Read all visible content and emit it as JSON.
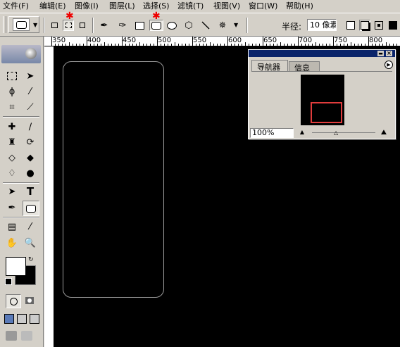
{
  "menubar": {
    "items": [
      {
        "label": "文件(F)"
      },
      {
        "label": "编辑(E)"
      },
      {
        "label": "图像(I)"
      },
      {
        "label": "图层(L)"
      },
      {
        "label": "选择(S)"
      },
      {
        "label": "滤镜(T)"
      },
      {
        "label": "视图(V)"
      },
      {
        "label": "窗口(W)"
      },
      {
        "label": "帮助(H)"
      }
    ]
  },
  "options": {
    "radius_label": "半径:",
    "radius_value": "10 像素"
  },
  "ruler": {
    "labels": [
      "350",
      "400",
      "450",
      "500",
      "550",
      "600",
      "650",
      "700",
      "750",
      "800"
    ]
  },
  "navigator": {
    "tab_navigator": "导航器",
    "tab_info": "信息",
    "zoom": "100%"
  },
  "colors": {
    "foreground": "#ffffff",
    "background": "#000000",
    "view_box": "#e03c3c",
    "panel_title": "#0a246a"
  }
}
